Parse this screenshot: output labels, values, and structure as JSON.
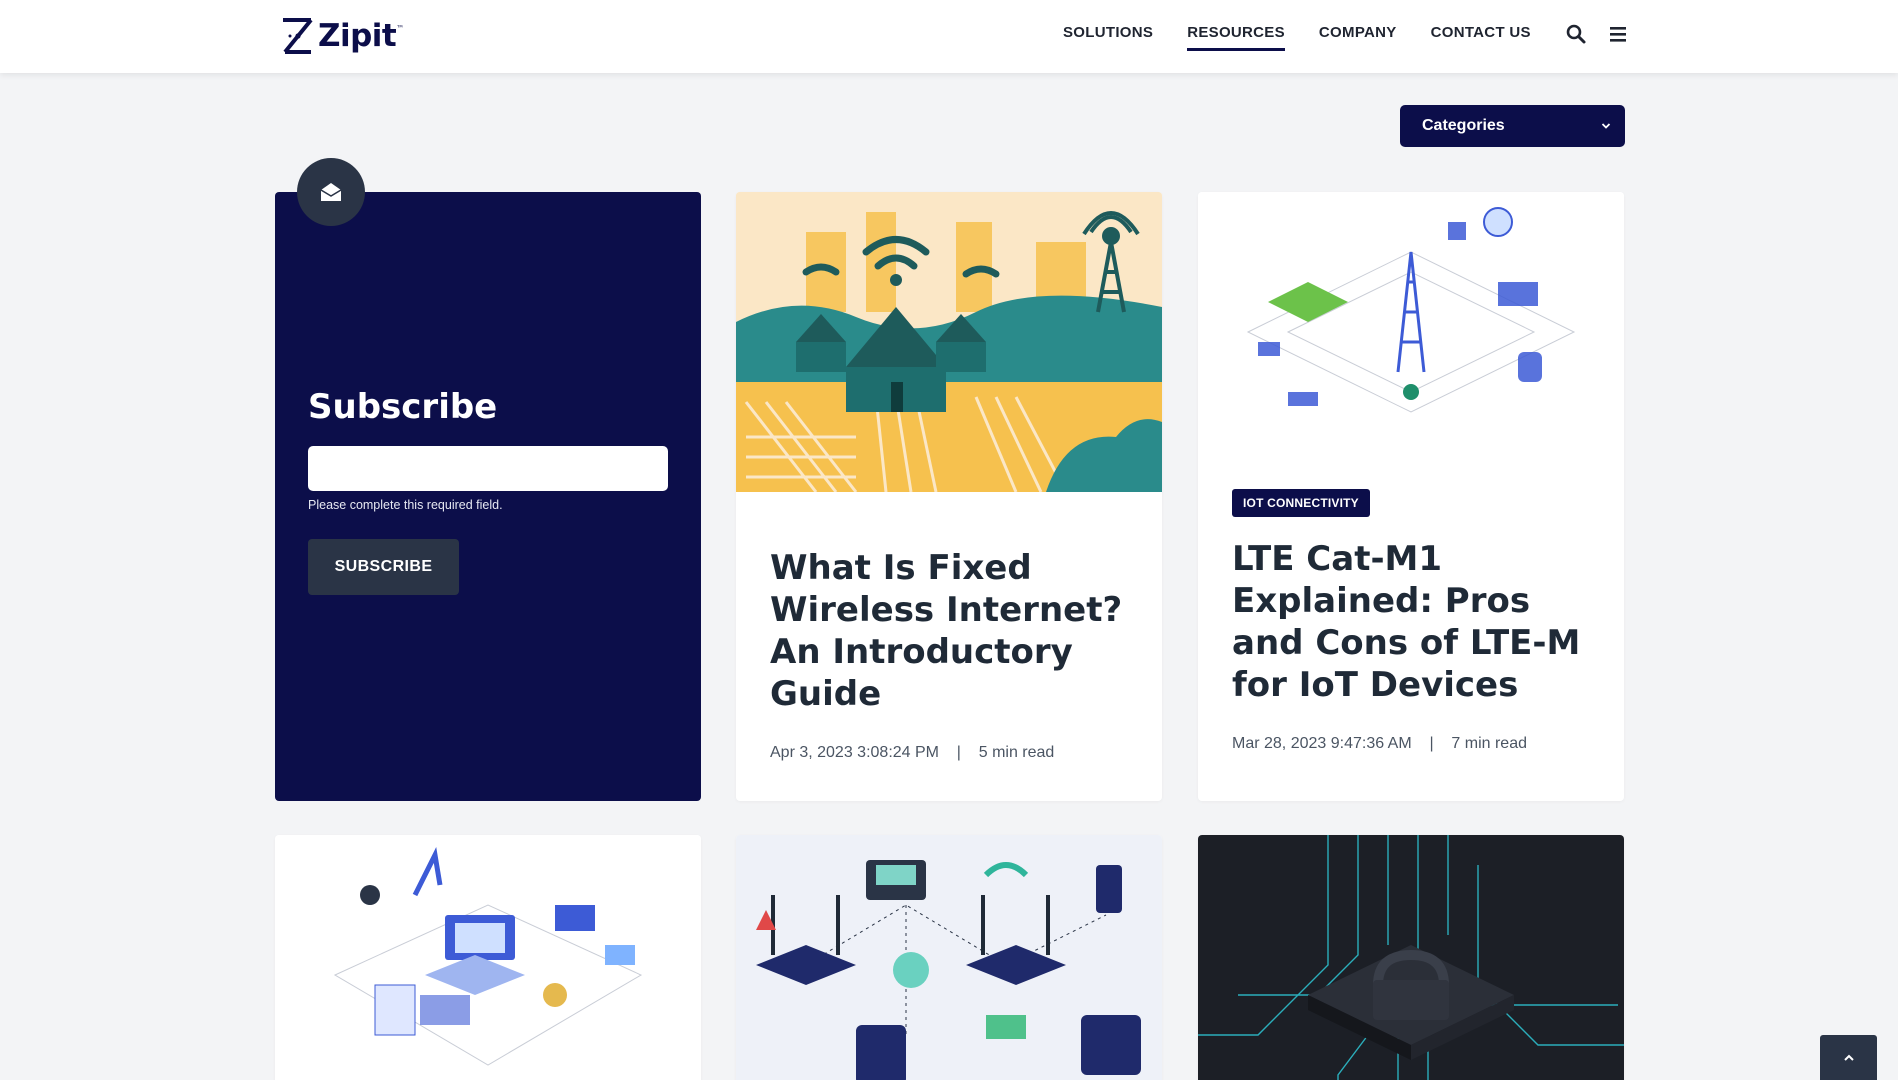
{
  "header": {
    "logo_text": "Zipit",
    "logo_mark": "™",
    "nav": [
      {
        "label": "SOLUTIONS"
      },
      {
        "label": "RESOURCES"
      },
      {
        "label": "COMPANY"
      },
      {
        "label": "CONTACT US"
      }
    ],
    "icons": [
      "search-icon",
      "hamburger-menu-icon"
    ]
  },
  "filters": {
    "categories_label": "Categories"
  },
  "subscribe": {
    "title": "Subscribe",
    "input_value": "",
    "error": "Please complete this required field.",
    "button": "SUBSCRIBE",
    "icon": "envelope-open-icon"
  },
  "posts": [
    {
      "title": "What Is Fixed Wireless Internet? An Introductory Guide",
      "date": "Apr 3, 2023 3:08:24 PM",
      "read_time": "5 min read"
    },
    {
      "tag": "IOT CONNECTIVITY",
      "title": "LTE Cat-M1 Explained: Pros and Cons of LTE-M for IoT Devices",
      "date": "Mar 28, 2023 9:47:36 AM",
      "read_time": "7 min read"
    }
  ],
  "colors": {
    "brand_navy": "#0c0e4a",
    "dark_slate": "#2a3446",
    "page_bg": "#f3f4f6"
  }
}
